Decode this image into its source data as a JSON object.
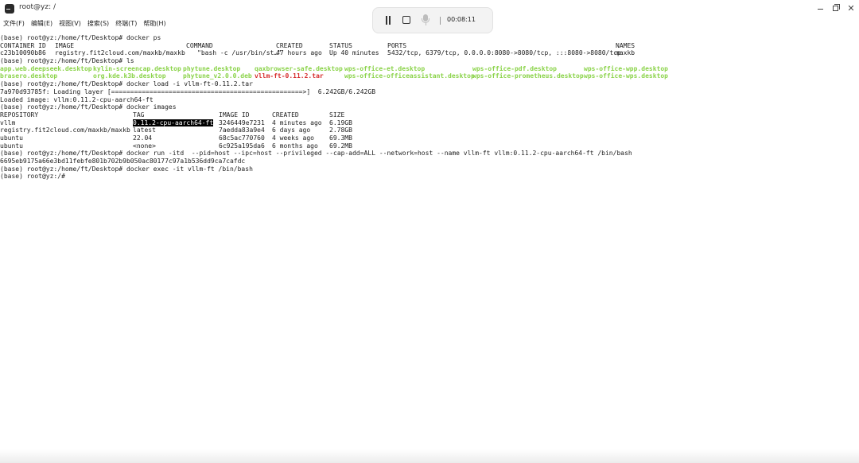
{
  "window": {
    "title": "root@yz: /",
    "icon": "terminal-icon"
  },
  "menu": [
    "文件(F)",
    "编辑(E)",
    "视图(V)",
    "搜索(S)",
    "终端(T)",
    "帮助(H)"
  ],
  "recorder": {
    "time": "00:08:11",
    "icons": [
      "pause-icon",
      "stop-icon",
      "microphone-icon"
    ]
  },
  "terminal": {
    "l01": "(base) root@yz:/home/ft/Desktop# docker ps",
    "ps_header": [
      "CONTAINER ID",
      "IMAGE",
      "COMMAND",
      "CREATED",
      "STATUS",
      "PORTS",
      "NAMES"
    ],
    "ps_row": [
      "c23b10090b86",
      "registry.fit2cloud.com/maxkb/maxkb",
      "\"bash -c /usr/bin/st…\"",
      "47 hours ago",
      "Up 40 minutes",
      "5432/tcp, 6379/tcp, 0.0.0.0:8080->8080/tcp, :::8080->8080/tcp",
      "maxkb"
    ],
    "l04": "(base) root@yz:/home/ft/Desktop# ls",
    "ls_row1": [
      "app.web.deepseek.desktop",
      "kylin-screencap.desktop",
      "phytune.desktop",
      "qaxbrowser-safe.desktop",
      "wps-office-et.desktop",
      "wps-office-pdf.desktop",
      "wps-office-wpp.desktop"
    ],
    "ls_row2": [
      "brasero.desktop",
      "org.kde.k3b.desktop",
      "phytune_v2.0.0.deb",
      "vllm-ft-0.11.2.tar",
      "wps-office-officeassistant.desktop",
      "wps-office-prometheus.desktop",
      "wps-office-wps.desktop"
    ],
    "l07": "(base) root@yz:/home/ft/Desktop# docker load -i vllm-ft-0.11.2.tar",
    "l08": "7a970d93785f: Loading layer [==================================================>]  6.242GB/6.242GB",
    "l09": "Loaded image: vllm:0.11.2-cpu-aarch64-ft",
    "l10": "(base) root@yz:/home/ft/Desktop# docker images",
    "img_header": [
      "REPOSITORY",
      "TAG",
      "IMAGE ID",
      "CREATED",
      "SIZE"
    ],
    "img_rows": [
      [
        "vllm",
        "0.11.2-cpu-aarch64-ft",
        "3246449e7231",
        "4 minutes ago",
        "6.19GB"
      ],
      [
        "registry.fit2cloud.com/maxkb/maxkb",
        "latest",
        "7aedda83a9e4",
        "6 days ago",
        "2.78GB"
      ],
      [
        "ubuntu",
        "22.04",
        "68c5ac770760",
        "4 weeks ago",
        "69.3MB"
      ],
      [
        "ubuntu",
        "<none>",
        "6c925a195da6",
        "6 months ago",
        "69.2MB"
      ]
    ],
    "l16": "(base) root@yz:/home/ft/Desktop# docker run -itd  --pid=host --ipc=host --privileged --cap-add=ALL --network=host --name vllm-ft vllm:0.11.2-cpu-aarch64-ft /bin/bash",
    "l17": "6695eb9175a66e3bd11febfe801b702b9b050ac80177c97a1b536dd9ca7cafdc",
    "l18": "(base) root@yz:/home/ft/Desktop# docker exec -it vllm-ft /bin/bash",
    "l19": "(base) root@yz:/#",
    "colors": {
      "executable": "#8bd34a",
      "archive": "#d62b2b",
      "selection_bg": "#000000"
    }
  }
}
